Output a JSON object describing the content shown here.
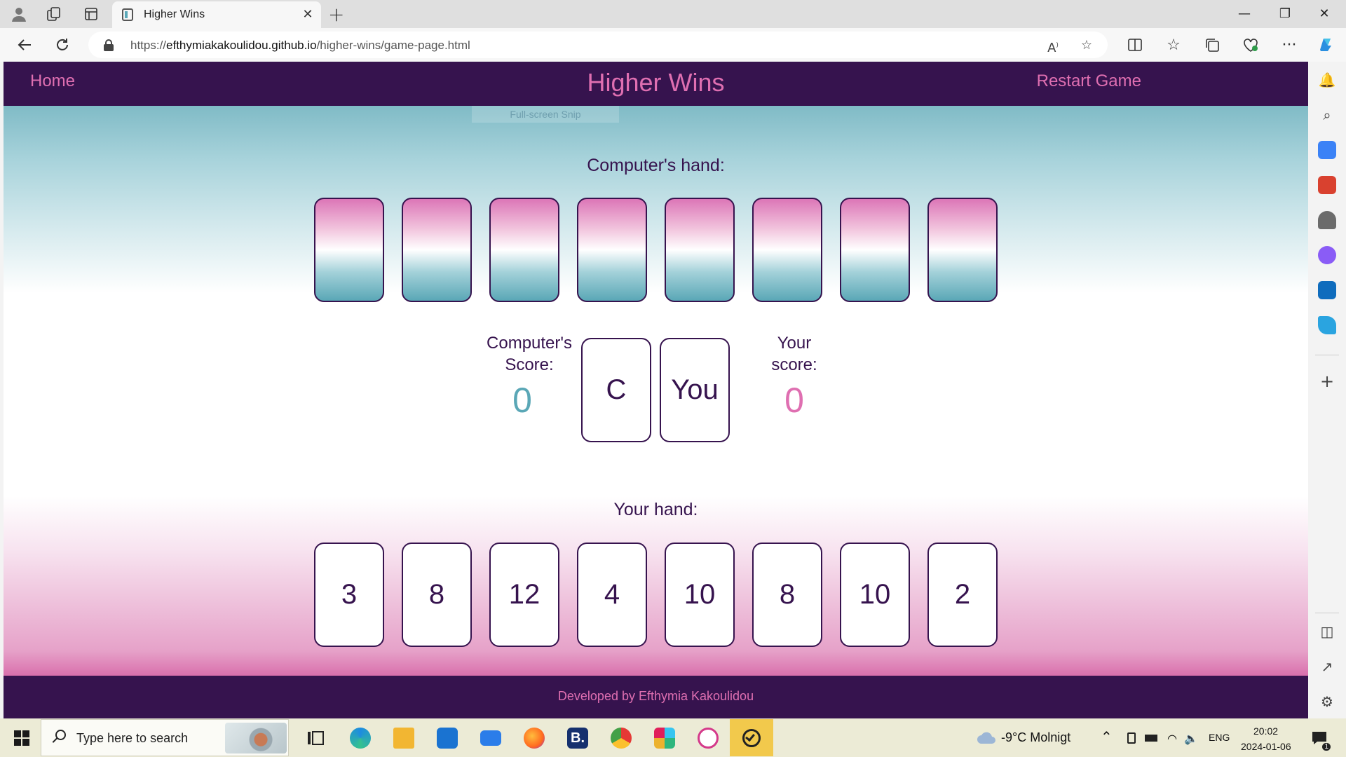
{
  "browser": {
    "tab_title": "Higher Wins",
    "url_domain": "efthymiakakoulidou.github.io",
    "url_path": "/higher-wins/game-page.html",
    "url_scheme": "https://"
  },
  "site": {
    "nav_home": "Home",
    "title": "Higher Wins",
    "nav_restart": "Restart Game",
    "snip_hint": "Full-screen Snip",
    "footer": "Developed by Efthymia Kakoulidou"
  },
  "game": {
    "computer_hand_label": "Computer's hand:",
    "computer_hand_count": 8,
    "computer_score_label_line1": "Computer's",
    "computer_score_label_line2": "Score:",
    "computer_score": "0",
    "played_computer_card": "C",
    "played_player_card": "You",
    "player_score_label_line1": "Your",
    "player_score_label_line2": "score:",
    "player_score": "0",
    "player_hand_label": "Your hand:",
    "player_hand": [
      "3",
      "8",
      "12",
      "4",
      "10",
      "8",
      "10",
      "2"
    ]
  },
  "colors": {
    "header_bg": "#36134e",
    "accent_pink": "#df6fb1",
    "accent_teal": "#5aa7b6"
  },
  "taskbar": {
    "search_placeholder": "Type here to search",
    "weather": "-9°C  Molnigt",
    "language": "ENG",
    "time": "20:02",
    "date": "2024-01-06",
    "notification_count": "1"
  }
}
